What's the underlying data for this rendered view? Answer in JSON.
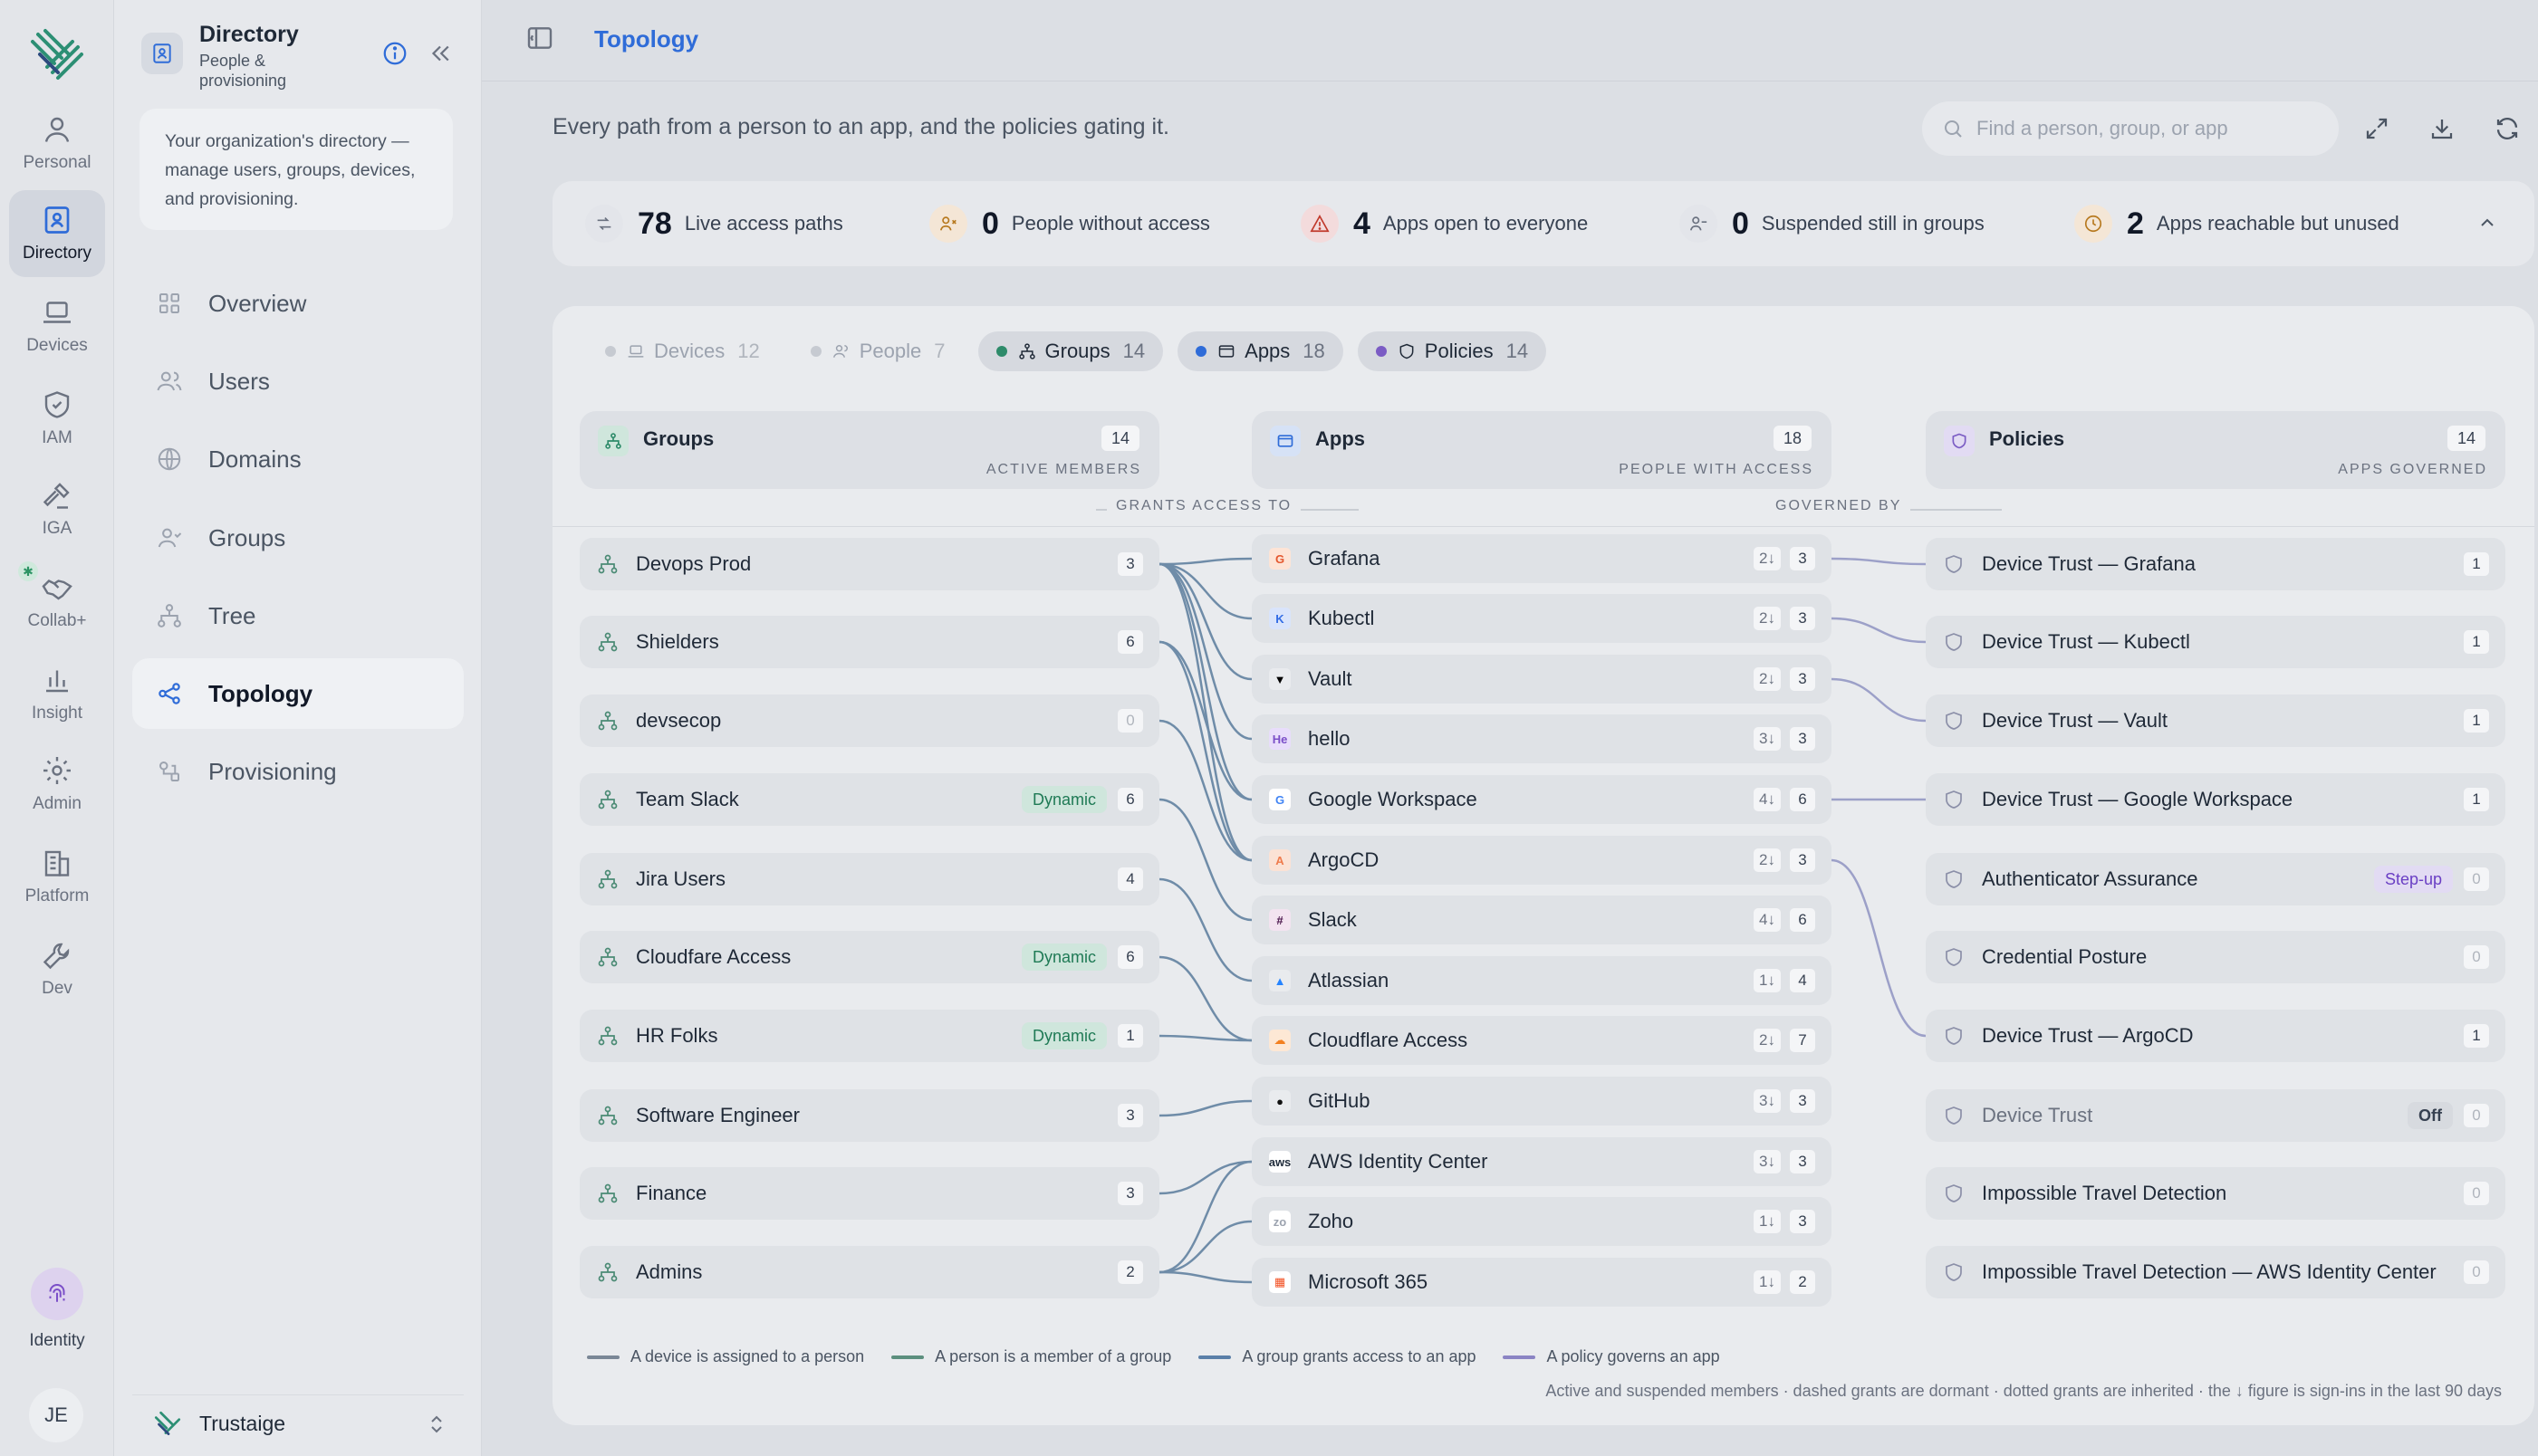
{
  "rail": {
    "items": [
      {
        "label": "Personal",
        "icon": "person-icon"
      },
      {
        "label": "Directory",
        "icon": "directory-icon",
        "active": true
      },
      {
        "label": "Devices",
        "icon": "laptop-icon"
      },
      {
        "label": "IAM",
        "icon": "shield-icon"
      },
      {
        "label": "IGA",
        "icon": "gavel-icon"
      },
      {
        "label": "Collab+",
        "icon": "handshake-icon"
      },
      {
        "label": "Insight",
        "icon": "bar-chart-icon"
      },
      {
        "label": "Admin",
        "icon": "gear-icon"
      },
      {
        "label": "Platform",
        "icon": "building-icon"
      },
      {
        "label": "Dev",
        "icon": "wrench-icon"
      }
    ],
    "identity_label": "Identity",
    "avatar_initials": "JE"
  },
  "sidebar": {
    "title": "Directory",
    "subtitle": "People & provisioning",
    "description": "Your organization's directory — manage users, groups, devices, and provisioning.",
    "nav": [
      {
        "label": "Overview",
        "icon": "grid-icon"
      },
      {
        "label": "Users",
        "icon": "users-icon"
      },
      {
        "label": "Domains",
        "icon": "globe-icon"
      },
      {
        "label": "Groups",
        "icon": "group-icon"
      },
      {
        "label": "Tree",
        "icon": "tree-icon"
      },
      {
        "label": "Topology",
        "icon": "share-icon",
        "active": true
      },
      {
        "label": "Provisioning",
        "icon": "provision-icon"
      }
    ],
    "org_name": "Trustaige"
  },
  "topbar": {
    "breadcrumb": "Topology"
  },
  "header": {
    "subtitle": "Every path from a person to an app, and the policies gating it.",
    "search_placeholder": "Find a person, group, or app"
  },
  "stats": [
    {
      "value": "78",
      "label": "Live access paths",
      "color": "#e3e5ea",
      "fg": "#6b7280"
    },
    {
      "value": "0",
      "label": "People without access",
      "color": "#f4e6d6",
      "fg": "#b7791f"
    },
    {
      "value": "4",
      "label": "Apps open to everyone",
      "color": "#f3dbdc",
      "fg": "#c0392b"
    },
    {
      "value": "0",
      "label": "Suspended still in groups",
      "color": "#e3e5ea",
      "fg": "#6b7280"
    },
    {
      "value": "2",
      "label": "Apps reachable but unused",
      "color": "#f4e6d6",
      "fg": "#b7791f"
    }
  ],
  "tabs": [
    {
      "label": "Devices",
      "count": "12",
      "on": false,
      "dot": "#c6cad1"
    },
    {
      "label": "People",
      "count": "7",
      "on": false,
      "dot": "#c6cad1"
    },
    {
      "label": "Groups",
      "count": "14",
      "on": true,
      "dot": "#2e8b6a"
    },
    {
      "label": "Apps",
      "count": "18",
      "on": true,
      "dot": "#2f6cd8"
    },
    {
      "label": "Policies",
      "count": "14",
      "on": true,
      "dot": "#7b5cc4"
    }
  ],
  "columns": {
    "groups": {
      "title": "Groups",
      "count": "14",
      "sub": "ACTIVE MEMBERS"
    },
    "apps": {
      "title": "Apps",
      "count": "18",
      "sub": "PEOPLE WITH ACCESS"
    },
    "policies": {
      "title": "Policies",
      "count": "14",
      "sub": "APPS GOVERNED"
    }
  },
  "connectors": {
    "grants": "GRANTS ACCESS TO",
    "governed": "GOVERNED BY"
  },
  "groups": [
    {
      "name": "Devops Prod",
      "count": "3",
      "tag": ""
    },
    {
      "name": "Shielders",
      "count": "6",
      "tag": ""
    },
    {
      "name": "devsecop",
      "count": "0",
      "tag": ""
    },
    {
      "name": "Team Slack",
      "count": "6",
      "tag": "Dynamic"
    },
    {
      "name": "Jira Users",
      "count": "4",
      "tag": ""
    },
    {
      "name": "Cloudfare Access",
      "count": "6",
      "tag": "Dynamic"
    },
    {
      "name": "HR Folks",
      "count": "1",
      "tag": "Dynamic"
    },
    {
      "name": "Software Engineer",
      "count": "3",
      "tag": ""
    },
    {
      "name": "Finance",
      "count": "3",
      "tag": ""
    },
    {
      "name": "Admins",
      "count": "2",
      "tag": ""
    }
  ],
  "apps": [
    {
      "name": "Grafana",
      "signins": "2↓",
      "count": "3",
      "logo": "G",
      "bg": "#fde4d6",
      "fg": "#e4572e"
    },
    {
      "name": "Kubectl",
      "signins": "2↓",
      "count": "3",
      "logo": "K",
      "bg": "#d9e4fb",
      "fg": "#326ce5"
    },
    {
      "name": "Vault",
      "signins": "2↓",
      "count": "3",
      "logo": "▼",
      "bg": "#e9ebee",
      "fg": "#000000"
    },
    {
      "name": "hello",
      "signins": "3↓",
      "count": "3",
      "logo": "He",
      "bg": "#e8ddfb",
      "fg": "#7b4fc8"
    },
    {
      "name": "Google Workspace",
      "signins": "4↓",
      "count": "6",
      "logo": "G",
      "bg": "#ffffff",
      "fg": "#4285f4"
    },
    {
      "name": "ArgoCD",
      "signins": "2↓",
      "count": "3",
      "logo": "A",
      "bg": "#fbe2d5",
      "fg": "#ef7b4d"
    },
    {
      "name": "Slack",
      "signins": "4↓",
      "count": "6",
      "logo": "#",
      "bg": "#f3e3f0",
      "fg": "#4a154b"
    },
    {
      "name": "Atlassian",
      "signins": "1↓",
      "count": "4",
      "logo": "▲",
      "bg": "#e9ebee",
      "fg": "#2684ff"
    },
    {
      "name": "Cloudflare Access",
      "signins": "2↓",
      "count": "7",
      "logo": "☁",
      "bg": "#fde8d5",
      "fg": "#f38020"
    },
    {
      "name": "GitHub",
      "signins": "3↓",
      "count": "3",
      "logo": "●",
      "bg": "#e9ebee",
      "fg": "#111111"
    },
    {
      "name": "AWS Identity Center",
      "signins": "3↓",
      "count": "3",
      "logo": "aws",
      "bg": "#ffffff",
      "fg": "#232f3e"
    },
    {
      "name": "Zoho",
      "signins": "1↓",
      "count": "3",
      "logo": "zo",
      "bg": "#ffffff",
      "fg": "#9ca3af"
    },
    {
      "name": "Microsoft 365",
      "signins": "1↓",
      "count": "2",
      "logo": "▦",
      "bg": "#ffffff",
      "fg": "#f25022"
    }
  ],
  "policies": [
    {
      "name": "Device Trust — Grafana",
      "count": "1",
      "tag": "",
      "muted": false
    },
    {
      "name": "Device Trust — Kubectl",
      "count": "1",
      "tag": "",
      "muted": false
    },
    {
      "name": "Device Trust — Vault",
      "count": "1",
      "tag": "",
      "muted": false
    },
    {
      "name": "Device Trust — Google Workspace",
      "count": "1",
      "tag": "",
      "muted": false
    },
    {
      "name": "Authenticator Assurance",
      "count": "0",
      "tag": "Step-up",
      "muted": false
    },
    {
      "name": "Credential Posture",
      "count": "0",
      "tag": "",
      "muted": false
    },
    {
      "name": "Device Trust — ArgoCD",
      "count": "1",
      "tag": "",
      "muted": false
    },
    {
      "name": "Device Trust",
      "count": "0",
      "tag": "Off",
      "muted": true
    },
    {
      "name": "Impossible Travel Detection",
      "count": "0",
      "tag": "",
      "muted": false
    },
    {
      "name": "Impossible Travel Detection — AWS Identity Center",
      "count": "0",
      "tag": "",
      "muted": false
    }
  ],
  "legend": [
    {
      "label": "A device is assigned to a person",
      "color": "#7a8796"
    },
    {
      "label": "A person is a member of a group",
      "color": "#5c8f7e"
    },
    {
      "label": "A group grants access to an app",
      "color": "#5a7fa8"
    },
    {
      "label": "A policy governs an app",
      "color": "#8b84c4"
    }
  ],
  "footnote": "Active and suspended members · dashed grants are dormant · dotted grants are inherited · the ↓ figure is sign-ins in the last 90 days",
  "colors": {
    "accent": "#2f6cd8",
    "link_grant": "#6f8ca8",
    "link_policy": "#9ca0c8"
  }
}
